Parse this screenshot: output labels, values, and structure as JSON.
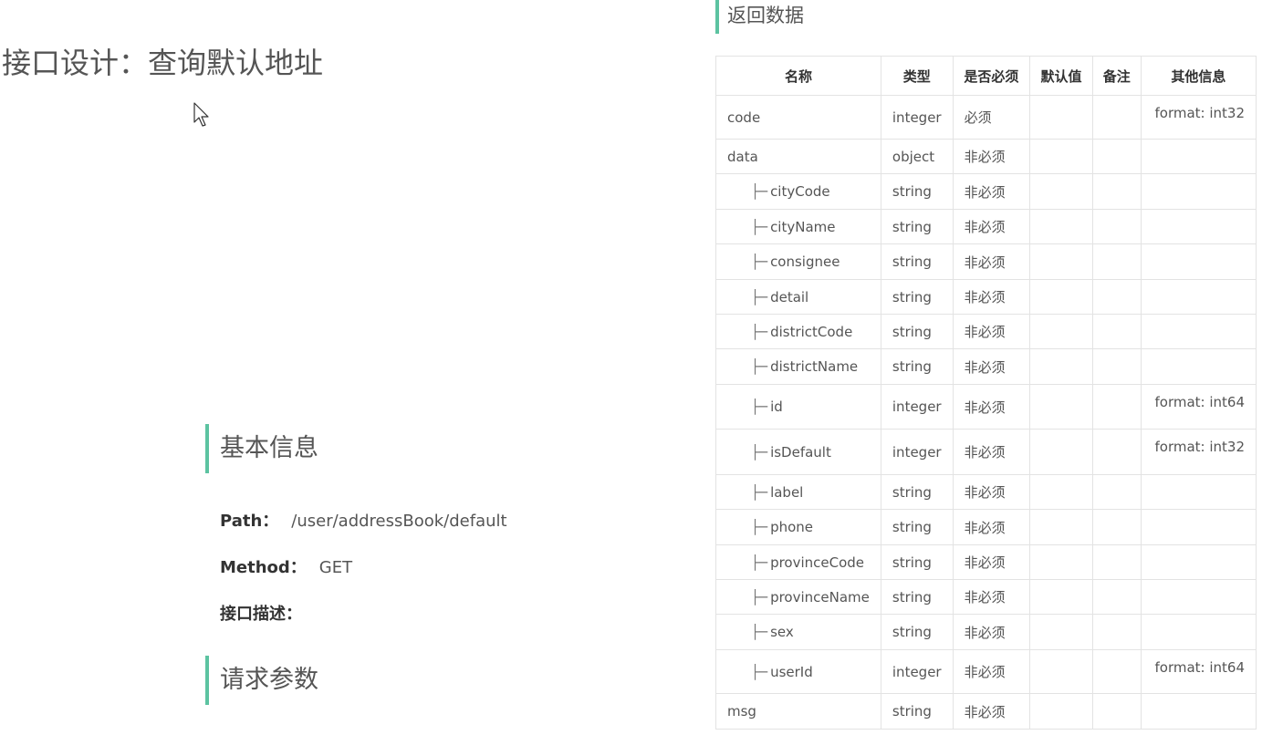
{
  "page": {
    "title": "接口设计：查询默认地址"
  },
  "basic_info": {
    "heading": "基本信息",
    "path_label": "Path：",
    "path_value": "/user/addressBook/default",
    "method_label": "Method：",
    "method_value": "GET",
    "desc_label": "接口描述："
  },
  "request_params": {
    "heading": "请求参数"
  },
  "return_data": {
    "heading": "返回数据",
    "columns": [
      "名称",
      "类型",
      "是否必须",
      "默认值",
      "备注",
      "其他信息"
    ],
    "tree_prefix": "├─",
    "rows": [
      {
        "name": "code",
        "indent": false,
        "type": "integer",
        "required": "必须",
        "default": "",
        "note": "",
        "other": "format: int32"
      },
      {
        "name": "data",
        "indent": false,
        "type": "object",
        "required": "非必须",
        "default": "",
        "note": "",
        "other": ""
      },
      {
        "name": "cityCode",
        "indent": true,
        "type": "string",
        "required": "非必须",
        "default": "",
        "note": "",
        "other": ""
      },
      {
        "name": "cityName",
        "indent": true,
        "type": "string",
        "required": "非必须",
        "default": "",
        "note": "",
        "other": ""
      },
      {
        "name": "consignee",
        "indent": true,
        "type": "string",
        "required": "非必须",
        "default": "",
        "note": "",
        "other": ""
      },
      {
        "name": "detail",
        "indent": true,
        "type": "string",
        "required": "非必须",
        "default": "",
        "note": "",
        "other": ""
      },
      {
        "name": "districtCode",
        "indent": true,
        "type": "string",
        "required": "非必须",
        "default": "",
        "note": "",
        "other": ""
      },
      {
        "name": "districtName",
        "indent": true,
        "type": "string",
        "required": "非必须",
        "default": "",
        "note": "",
        "other": ""
      },
      {
        "name": "id",
        "indent": true,
        "type": "integer",
        "required": "非必须",
        "default": "",
        "note": "",
        "other": "format: int64"
      },
      {
        "name": "isDefault",
        "indent": true,
        "type": "integer",
        "required": "非必须",
        "default": "",
        "note": "",
        "other": "format: int32"
      },
      {
        "name": "label",
        "indent": true,
        "type": "string",
        "required": "非必须",
        "default": "",
        "note": "",
        "other": ""
      },
      {
        "name": "phone",
        "indent": true,
        "type": "string",
        "required": "非必须",
        "default": "",
        "note": "",
        "other": ""
      },
      {
        "name": "provinceCode",
        "indent": true,
        "type": "string",
        "required": "非必须",
        "default": "",
        "note": "",
        "other": ""
      },
      {
        "name": "provinceName",
        "indent": true,
        "type": "string",
        "required": "非必须",
        "default": "",
        "note": "",
        "other": ""
      },
      {
        "name": "sex",
        "indent": true,
        "type": "string",
        "required": "非必须",
        "default": "",
        "note": "",
        "other": ""
      },
      {
        "name": "userId",
        "indent": true,
        "type": "integer",
        "required": "非必须",
        "default": "",
        "note": "",
        "other": "format: int64"
      },
      {
        "name": "msg",
        "indent": false,
        "type": "string",
        "required": "非必须",
        "default": "",
        "note": "",
        "other": ""
      }
    ]
  },
  "colors": {
    "accent": "#5cc3a1",
    "text": "#555555",
    "border": "#e3e3e3"
  },
  "icons": {
    "cursor": "mouse-pointer-icon"
  }
}
